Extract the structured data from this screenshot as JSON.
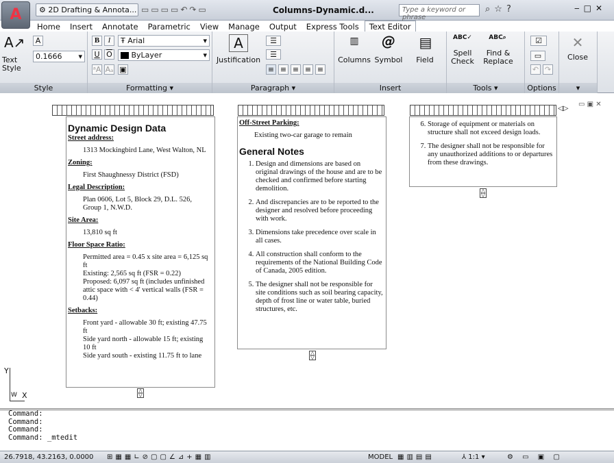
{
  "title_bar": {
    "workspace": "2D Drafting & Annota...",
    "doc_title": "Columns-Dynamic.d...",
    "search_placeholder": "Type a keyword or phrase"
  },
  "tabs": [
    "Home",
    "Insert",
    "Annotate",
    "Parametric",
    "View",
    "Manage",
    "Output",
    "Express Tools",
    "Text Editor"
  ],
  "active_tab": "Text Editor",
  "ribbon": {
    "style": {
      "text_style_label": "Text Style",
      "height": "0.1666",
      "title": "Style"
    },
    "formatting": {
      "font": "Arial",
      "color": "ByLayer",
      "title": "Formatting"
    },
    "paragraph": {
      "justification": "Justification",
      "title": "Paragraph"
    },
    "insert": {
      "columns": "Columns",
      "symbol": "Symbol",
      "field": "Field",
      "title": "Insert"
    },
    "tools": {
      "spell_check": "Spell Check",
      "find_replace": "Find & Replace",
      "title": "Tools"
    },
    "options": {
      "title": "Options"
    },
    "close": {
      "label": "Close"
    }
  },
  "col1": {
    "heading": "Dynamic Design Data",
    "street_h": "Street address:",
    "street": "1313 Mockingbird Lane, West Walton, NL",
    "zoning_h": "Zoning:",
    "zoning": "First Shaughnessy District (FSD)",
    "legal_h": "Legal Description:",
    "legal": "Plan 0606, Lot 5, Block 29, D.L. 526, Group 1, N.W.D.",
    "site_h": "Site Area:",
    "site": "13,810 sq ft",
    "fsr_h": "Floor Space Ratio:",
    "fsr1": "Permitted area = 0.45 x site area = 6,125 sq ft",
    "fsr2": "Existing: 2,565 sq ft (FSR = 0.22)",
    "fsr3": "Proposed: 6,097 sq ft (includes unfinished attic space with < 4' vertical walls (FSR = 0.44)",
    "setbacks_h": "Setbacks:",
    "sb1": "Front yard - allowable 30 ft; existing 47.75 ft",
    "sb2": "Side yard north - allowable 15 ft; existing 10 ft",
    "sb3": "Side yard south - existing 11.75 ft to lane"
  },
  "col2": {
    "parking_h": "Off-Street Parking:",
    "parking": "Existing two-car garage to remain",
    "notes_h": "General Notes",
    "notes": [
      "Design and dimensions are based on original drawings of the house and are to be checked and confirmed before starting demolition.",
      "And discrepancies are to be reported to the designer and resolved before proceeding with work.",
      "Dimensions take precedence over scale in all cases.",
      "All construction shall conform to the requirements of the National Building Code of Canada, 2005 edition.",
      "The designer shall not be responsible for site conditions such as soil bearing capacity, depth of frost line or water table, buried structures, etc."
    ]
  },
  "col3": {
    "notes": [
      "Storage of equipment or materials on structure shall not exceed design loads.",
      "The designer shall not be responsible for any unauthorized additions to or departures from these drawings."
    ]
  },
  "ucs": {
    "y": "Y",
    "x": "X",
    "w": "W"
  },
  "command_lines": [
    "Command:",
    "Command:",
    "Command:",
    "Command:  _mtedit"
  ],
  "status": {
    "coords": "26.7918, 43.2163, 0.0000",
    "model": "MODEL",
    "scale": "1:1"
  }
}
